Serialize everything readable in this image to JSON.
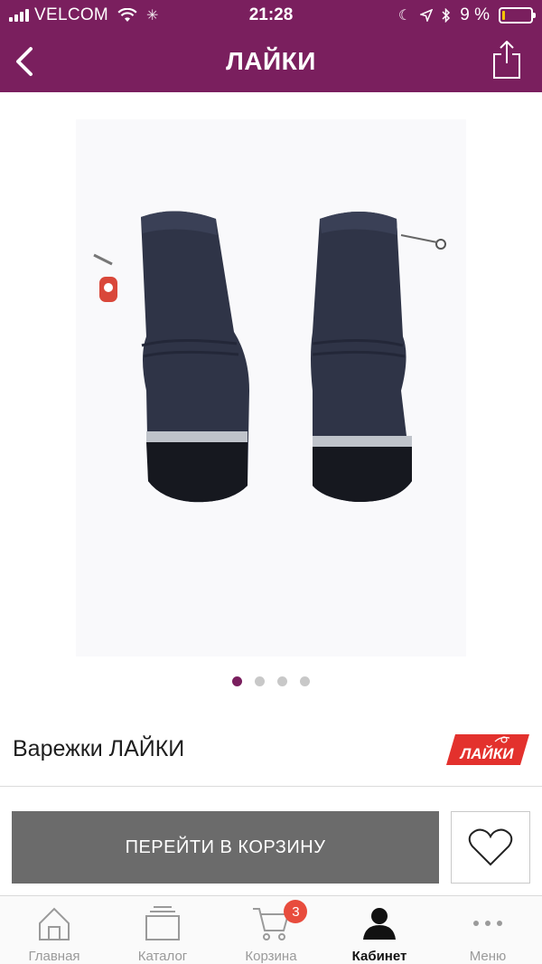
{
  "status_bar": {
    "carrier": "VELCOM",
    "time": "21:28",
    "battery_percent": "9 %",
    "battery_level": 0.09
  },
  "nav": {
    "title": "ЛАЙКИ",
    "back_icon": "chevron-left-icon",
    "share_icon": "share-icon"
  },
  "gallery": {
    "image": "mittens-photo",
    "page_count": 4,
    "active_page": 1
  },
  "product": {
    "title": "Варежки ЛАЙКИ",
    "brand_logo_text": "ЛАЙКИ"
  },
  "actions": {
    "cart_button_label": "ПЕРЕЙТИ В КОРЗИНУ",
    "favorite_icon": "heart-icon"
  },
  "tabbar": {
    "items": [
      {
        "label": "Главная",
        "icon": "home-icon"
      },
      {
        "label": "Каталог",
        "icon": "catalog-icon"
      },
      {
        "label": "Корзина",
        "icon": "cart-icon",
        "badge": "3"
      },
      {
        "label": "Кабинет",
        "icon": "user-icon",
        "active": true
      },
      {
        "label": "Меню",
        "icon": "more-icon"
      }
    ]
  },
  "colors": {
    "brand": "#7a1f5e",
    "button": "#6b6b6b",
    "badge": "#e84c3d",
    "logo": "#e3312d"
  }
}
